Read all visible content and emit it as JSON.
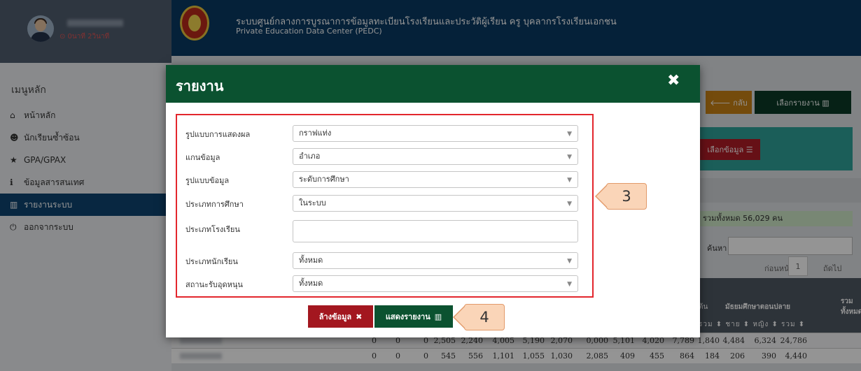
{
  "sidebar": {
    "profile_status": "⊙ 0นาที 2วินาที",
    "menu_title": "เมนูหลัก",
    "items": [
      {
        "icon": "home-icon",
        "glyph": "⌂",
        "label": "หน้าหลัก",
        "active": false
      },
      {
        "icon": "users-icon",
        "glyph": "☻",
        "label": "นักเรียนซ้ำซ้อน",
        "active": false
      },
      {
        "icon": "star-icon",
        "glyph": "★",
        "label": "GPA/GPAX",
        "active": false
      },
      {
        "icon": "info-icon",
        "glyph": "ℹ",
        "label": "ข้อมูลสารสนเทศ",
        "active": false
      },
      {
        "icon": "bar-chart-icon",
        "glyph": "▥",
        "label": "รายงานระบบ",
        "active": true
      },
      {
        "icon": "power-icon",
        "glyph": "⏻",
        "label": "ออกจากระบบ",
        "active": false
      }
    ]
  },
  "header": {
    "title": "ระบบศูนย์กลางการบูรณาการข้อมูลทะเบียนโรงเรียนและประวัติผู้เรียน ครู บุคลากรโรงเรียนเอกชน",
    "subtitle": "Private Education Data Center (PEDC)"
  },
  "background": {
    "back_label": "🡐 กลับ",
    "choose_report_label": "เลือกรายงาน ▥",
    "choose_data_label": "เลือกข้อมูล ☰",
    "total_text": ", รวมทั้งหมด 56,029 คน",
    "search_label": "ค้นหา",
    "pager_prev": "ก่อนหน้า",
    "pager_page": "1",
    "pager_next": "ถัดไป",
    "table_header": {
      "col_a": "ต้น",
      "col_b": "มัธยมศึกษาตอนปลาย",
      "col_c": "รวม ทั้งหมด",
      "sub": "รวม ⬍ ชาย ⬍ หญิง ⬍ รวม ⬍"
    },
    "rows": [
      [
        "0",
        "0",
        "0",
        "2,505",
        "2,240",
        "4,005",
        "5,190",
        "2,070",
        "0,000",
        "5,101",
        "4,020",
        "7,789",
        "1,840",
        "4,484",
        "6,324",
        "24,786"
      ],
      [
        "0",
        "0",
        "0",
        "545",
        "556",
        "1,101",
        "1,055",
        "1,030",
        "2,085",
        "409",
        "455",
        "864",
        "184",
        "206",
        "390",
        "4,440"
      ]
    ]
  },
  "modal": {
    "title": "รายงาน",
    "close_glyph": "✖",
    "fields": [
      {
        "label": "รูปแบบการแสดงผล",
        "type": "select",
        "value": "กราฟแท่ง"
      },
      {
        "label": "แกนข้อมูล",
        "type": "select",
        "value": "อำเภอ"
      },
      {
        "label": "รูปแบบข้อมูล",
        "type": "select",
        "value": "ระดับการศึกษา"
      },
      {
        "label": "ประเภทการศึกษา",
        "type": "select",
        "value": "ในระบบ"
      },
      {
        "label": "ประเภทโรงเรียน",
        "type": "input",
        "value": ""
      },
      {
        "label": "ประเภทนักเรียน",
        "type": "select",
        "value": "ทั้งหมด"
      },
      {
        "label": "สถานะรับอุดหนุน",
        "type": "select",
        "value": "ทั้งหมด"
      }
    ],
    "clear_label": "ล้างข้อมูล",
    "clear_glyph": "✖",
    "show_label": "แสดงรายงาน",
    "show_glyph": "▥"
  },
  "callouts": {
    "form": "3",
    "button": "4"
  }
}
